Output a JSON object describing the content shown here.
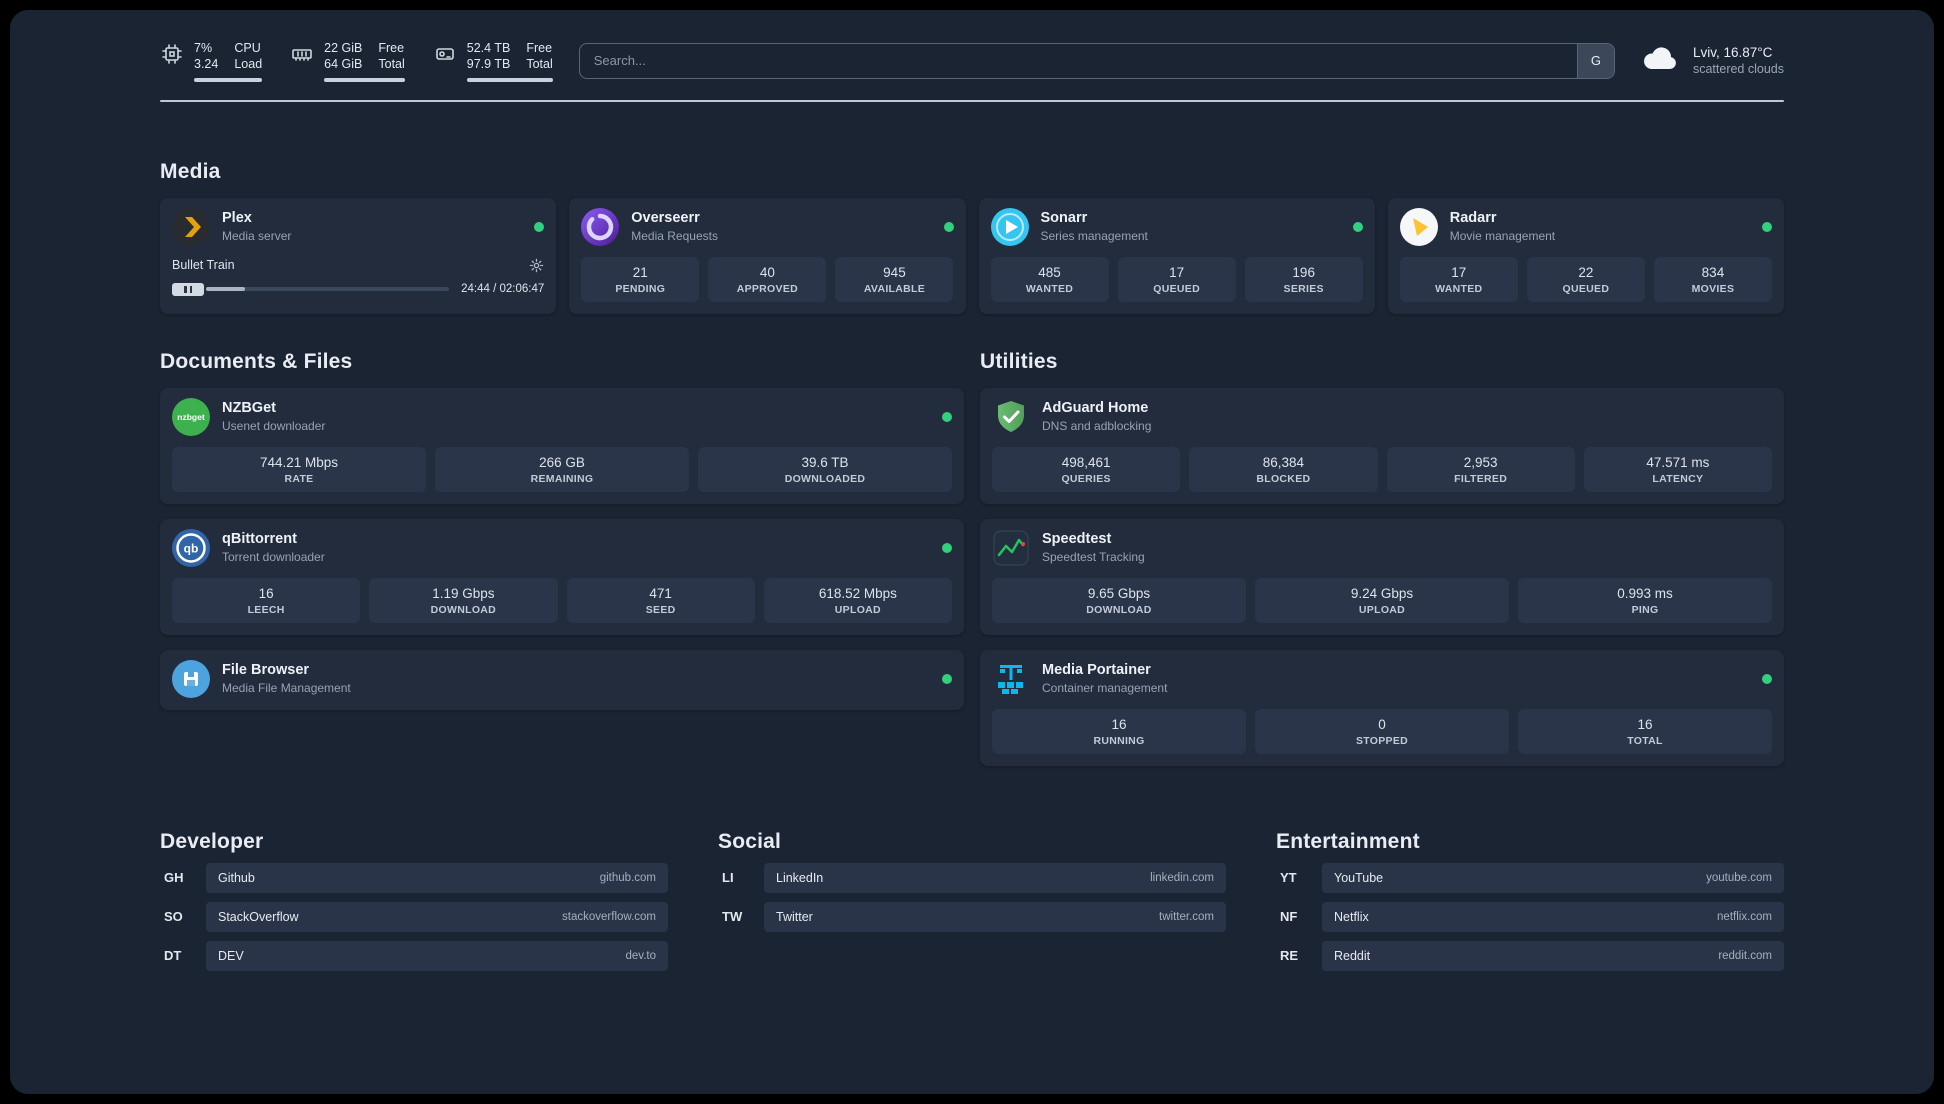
{
  "topbar": {
    "cpu": {
      "value_top": "7%",
      "value_bottom": "3.24",
      "label_top": "CPU",
      "label_bottom": "Load"
    },
    "memory": {
      "value_top": "22 GiB",
      "value_bottom": "64 GiB",
      "label_top": "Free",
      "label_bottom": "Total"
    },
    "disk": {
      "value_top": "52.4 TB",
      "value_bottom": "97.9 TB",
      "label_top": "Free",
      "label_bottom": "Total"
    },
    "search": {
      "placeholder": "Search...",
      "provider_button": "G"
    },
    "weather": {
      "location": "Lviv, 16.87°C",
      "condition": "scattered clouds"
    }
  },
  "sections": {
    "media": {
      "heading": "Media",
      "plex": {
        "name": "Plex",
        "subtitle": "Media server",
        "now_playing": "Bullet Train",
        "time": "24:44 / 02:06:47"
      },
      "overseerr": {
        "name": "Overseerr",
        "subtitle": "Media Requests",
        "stats": [
          {
            "value": "21",
            "label": "PENDING"
          },
          {
            "value": "40",
            "label": "APPROVED"
          },
          {
            "value": "945",
            "label": "AVAILABLE"
          }
        ]
      },
      "sonarr": {
        "name": "Sonarr",
        "subtitle": "Series management",
        "stats": [
          {
            "value": "485",
            "label": "WANTED"
          },
          {
            "value": "17",
            "label": "QUEUED"
          },
          {
            "value": "196",
            "label": "SERIES"
          }
        ]
      },
      "radarr": {
        "name": "Radarr",
        "subtitle": "Movie management",
        "stats": [
          {
            "value": "17",
            "label": "WANTED"
          },
          {
            "value": "22",
            "label": "QUEUED"
          },
          {
            "value": "834",
            "label": "MOVIES"
          }
        ]
      }
    },
    "documents": {
      "heading": "Documents & Files",
      "nzbget": {
        "name": "NZBGet",
        "subtitle": "Usenet downloader",
        "stats": [
          {
            "value": "744.21 Mbps",
            "label": "RATE"
          },
          {
            "value": "266 GB",
            "label": "REMAINING"
          },
          {
            "value": "39.6 TB",
            "label": "DOWNLOADED"
          }
        ]
      },
      "qbittorrent": {
        "name": "qBittorrent",
        "subtitle": "Torrent downloader",
        "stats": [
          {
            "value": "16",
            "label": "LEECH"
          },
          {
            "value": "1.19 Gbps",
            "label": "DOWNLOAD"
          },
          {
            "value": "471",
            "label": "SEED"
          },
          {
            "value": "618.52 Mbps",
            "label": "UPLOAD"
          }
        ]
      },
      "filebrowser": {
        "name": "File Browser",
        "subtitle": "Media File Management"
      }
    },
    "utilities": {
      "heading": "Utilities",
      "adguard": {
        "name": "AdGuard Home",
        "subtitle": "DNS and adblocking",
        "stats": [
          {
            "value": "498,461",
            "label": "QUERIES"
          },
          {
            "value": "86,384",
            "label": "BLOCKED"
          },
          {
            "value": "2,953",
            "label": "FILTERED"
          },
          {
            "value": "47.571 ms",
            "label": "LATENCY"
          }
        ]
      },
      "speedtest": {
        "name": "Speedtest",
        "subtitle": "Speedtest Tracking",
        "stats": [
          {
            "value": "9.65 Gbps",
            "label": "DOWNLOAD"
          },
          {
            "value": "9.24 Gbps",
            "label": "UPLOAD"
          },
          {
            "value": "0.993 ms",
            "label": "PING"
          }
        ]
      },
      "portainer": {
        "name": "Media Portainer",
        "subtitle": "Container management",
        "stats": [
          {
            "value": "16",
            "label": "RUNNING"
          },
          {
            "value": "0",
            "label": "STOPPED"
          },
          {
            "value": "16",
            "label": "TOTAL"
          }
        ]
      }
    },
    "bookmarks": {
      "developer": {
        "heading": "Developer",
        "items": [
          {
            "abbr": "GH",
            "name": "Github",
            "domain": "github.com"
          },
          {
            "abbr": "SO",
            "name": "StackOverflow",
            "domain": "stackoverflow.com"
          },
          {
            "abbr": "DT",
            "name": "DEV",
            "domain": "dev.to"
          }
        ]
      },
      "social": {
        "heading": "Social",
        "items": [
          {
            "abbr": "LI",
            "name": "LinkedIn",
            "domain": "linkedin.com"
          },
          {
            "abbr": "TW",
            "name": "Twitter",
            "domain": "twitter.com"
          }
        ]
      },
      "entertainment": {
        "heading": "Entertainment",
        "items": [
          {
            "abbr": "YT",
            "name": "YouTube",
            "domain": "youtube.com"
          },
          {
            "abbr": "NF",
            "name": "Netflix",
            "domain": "netflix.com"
          },
          {
            "abbr": "RE",
            "name": "Reddit",
            "domain": "reddit.com"
          }
        ]
      }
    }
  },
  "icons": {
    "nzbget_glyph": "nzbget",
    "qbittorrent_glyph": "qb"
  },
  "colors": {
    "background": "#1b2433",
    "card": "#222c3d",
    "stat_box": "#2b3549",
    "status_online": "#31d07c",
    "plex_accent": "#e5a00d",
    "speedtest_trace": "#22c55e"
  }
}
